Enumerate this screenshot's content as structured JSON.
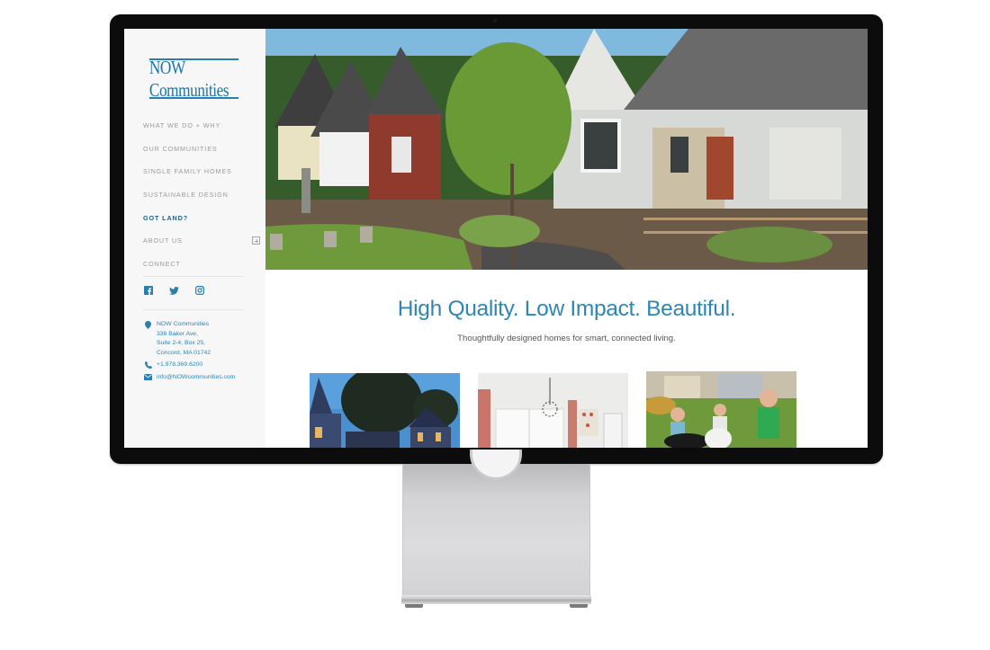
{
  "site": {
    "logo": "NOW Communities",
    "brand_color": "#1e76a8"
  },
  "sidebar": {
    "nav": [
      {
        "label": "WHAT WE DO + WHY",
        "active": false
      },
      {
        "label": "OUR COMMUNITIES",
        "active": false
      },
      {
        "label": "SINGLE FAMILY HOMES",
        "active": false
      },
      {
        "label": "SUSTAINABLE DESIGN",
        "active": false
      },
      {
        "label": "GOT LAND?",
        "active": true
      },
      {
        "label": "ABOUT US",
        "active": false,
        "expand_icon": "plus-square-icon"
      },
      {
        "label": "CONNECT",
        "active": false
      }
    ],
    "social": [
      {
        "name": "facebook",
        "icon": "facebook-icon"
      },
      {
        "name": "twitter",
        "icon": "twitter-icon"
      },
      {
        "name": "instagram",
        "icon": "instagram-icon"
      }
    ],
    "contact": {
      "address_lines": [
        "NOW Communities",
        "336 Baker Ave,",
        "Suite 2-4, Box 25,",
        "Concord, MA 01742"
      ],
      "phone": "+1.978.369.6200",
      "email": "info@NOWcommunities.com"
    }
  },
  "main": {
    "hero_alt": "Row of cottage-style homes with landscaped yards",
    "headline": "High Quality. Low Impact. Beautiful.",
    "subhead": "Thoughtfully designed homes for smart, connected living.",
    "thumbnails": [
      {
        "alt": "Homes at dusk beneath trees"
      },
      {
        "alt": "Bright interior with red curtains and chandelier"
      },
      {
        "alt": "Children with dogs on a lawn"
      }
    ]
  }
}
